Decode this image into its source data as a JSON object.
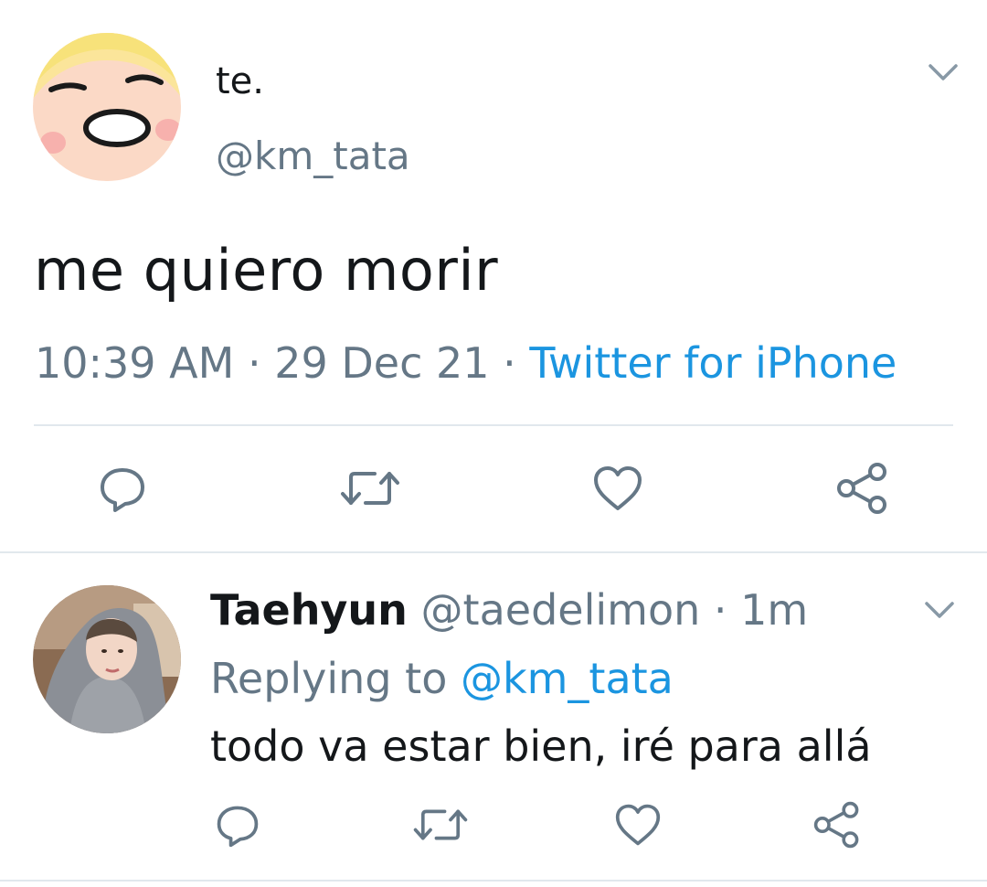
{
  "tweet": {
    "display_name": "te.",
    "handle": "@km_tata",
    "text": "me quiero morir",
    "time": "10:39 AM",
    "date": "29 Dec 21",
    "separator": " · ",
    "source": "Twitter for iPhone"
  },
  "reply": {
    "display_name": "Taehyun",
    "handle": "@taedelimon",
    "age": "1m",
    "separator": " · ",
    "replying_prefix": "Replying to ",
    "replying_handle": "@km_tata",
    "text": "todo va estar bien, iré para allá"
  },
  "icons": {
    "reply": "reply-icon",
    "retweet": "retweet-icon",
    "like": "heart-icon",
    "share": "share-icon",
    "menu": "chevron-down-icon"
  },
  "colors": {
    "text": "#14171a",
    "secondary": "#657786",
    "link": "#1b95e0",
    "divider": "#e1e8ed"
  }
}
